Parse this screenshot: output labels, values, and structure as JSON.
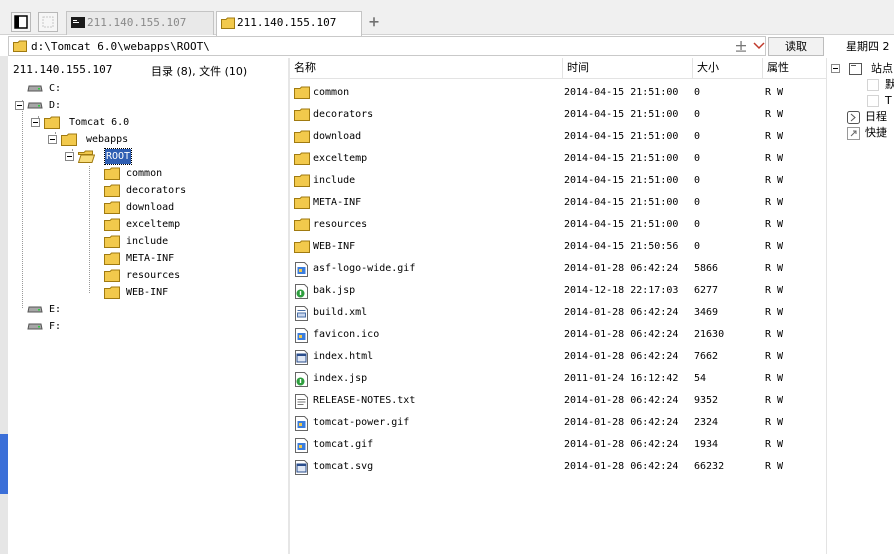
{
  "tabs": [
    {
      "label": "211.140.155.107",
      "icon": "terminal-icon",
      "active": false
    },
    {
      "label": "211.140.155.107",
      "icon": "folder-icon",
      "active": true
    }
  ],
  "toolbar": {
    "path_value": "d:\\Tomcat 6.0\\webapps\\ROOT\\",
    "read_label": "读取",
    "date_label": "星期四 2"
  },
  "tree": {
    "server_label": "211.140.155.107",
    "count_label": "目录 (8), 文件 (10)",
    "nodes": [
      {
        "label": "C:",
        "type": "drive"
      },
      {
        "label": "D:",
        "type": "drive"
      },
      {
        "label": "Tomcat 6.0",
        "type": "folder"
      },
      {
        "label": "webapps",
        "type": "folder"
      },
      {
        "label": "ROOT",
        "type": "folder",
        "selected": true
      },
      {
        "label": "common",
        "type": "folder"
      },
      {
        "label": "decorators",
        "type": "folder"
      },
      {
        "label": "download",
        "type": "folder"
      },
      {
        "label": "exceltemp",
        "type": "folder"
      },
      {
        "label": "include",
        "type": "folder"
      },
      {
        "label": "META-INF",
        "type": "folder"
      },
      {
        "label": "resources",
        "type": "folder"
      },
      {
        "label": "WEB-INF",
        "type": "folder"
      },
      {
        "label": "E:",
        "type": "drive"
      },
      {
        "label": "F:",
        "type": "drive"
      }
    ]
  },
  "files": {
    "columns": {
      "name": "名称",
      "time": "时间",
      "size": "大小",
      "attr": "属性"
    },
    "rows": [
      {
        "name": "common",
        "time": "2014-04-15 21:51:00",
        "size": "0",
        "attr": "R W",
        "icon": "folder-icon"
      },
      {
        "name": "decorators",
        "time": "2014-04-15 21:51:00",
        "size": "0",
        "attr": "R W",
        "icon": "folder-icon"
      },
      {
        "name": "download",
        "time": "2014-04-15 21:51:00",
        "size": "0",
        "attr": "R W",
        "icon": "folder-icon"
      },
      {
        "name": "exceltemp",
        "time": "2014-04-15 21:51:00",
        "size": "0",
        "attr": "R W",
        "icon": "folder-icon"
      },
      {
        "name": "include",
        "time": "2014-04-15 21:51:00",
        "size": "0",
        "attr": "R W",
        "icon": "folder-icon"
      },
      {
        "name": "META-INF",
        "time": "2014-04-15 21:51:00",
        "size": "0",
        "attr": "R W",
        "icon": "folder-icon"
      },
      {
        "name": "resources",
        "time": "2014-04-15 21:51:00",
        "size": "0",
        "attr": "R W",
        "icon": "folder-icon"
      },
      {
        "name": "WEB-INF",
        "time": "2014-04-15 21:50:56",
        "size": "0",
        "attr": "R W",
        "icon": "folder-icon"
      },
      {
        "name": "asf-logo-wide.gif",
        "time": "2014-01-28 06:42:24",
        "size": "5866",
        "attr": "R W",
        "icon": "image-file-icon"
      },
      {
        "name": "bak.jsp",
        "time": "2014-12-18 22:17:03",
        "size": "6277",
        "attr": "R W",
        "icon": "jsp-file-icon"
      },
      {
        "name": "build.xml",
        "time": "2014-01-28 06:42:24",
        "size": "3469",
        "attr": "R W",
        "icon": "xml-file-icon"
      },
      {
        "name": "favicon.ico",
        "time": "2014-01-28 06:42:24",
        "size": "21630",
        "attr": "R W",
        "icon": "image-file-icon"
      },
      {
        "name": "index.html",
        "time": "2014-01-28 06:42:24",
        "size": "7662",
        "attr": "R W",
        "icon": "html-file-icon"
      },
      {
        "name": "index.jsp",
        "time": "2011-01-24 16:12:42",
        "size": "54",
        "attr": "R W",
        "icon": "jsp-file-icon"
      },
      {
        "name": "RELEASE-NOTES.txt",
        "time": "2014-01-28 06:42:24",
        "size": "9352",
        "attr": "R W",
        "icon": "text-file-icon"
      },
      {
        "name": "tomcat-power.gif",
        "time": "2014-01-28 06:42:24",
        "size": "2324",
        "attr": "R W",
        "icon": "image-file-icon"
      },
      {
        "name": "tomcat.gif",
        "time": "2014-01-28 06:42:24",
        "size": "1934",
        "attr": "R W",
        "icon": "image-file-icon"
      },
      {
        "name": "tomcat.svg",
        "time": "2014-01-28 06:42:24",
        "size": "66232",
        "attr": "R W",
        "icon": "html-file-icon"
      }
    ]
  },
  "right_panel": {
    "site_label": "站点",
    "sub_a": "默",
    "sub_b": "T",
    "schedule_label": "日程",
    "shortcut_label": "快捷"
  },
  "colors": {
    "selection": "#2f5fb3",
    "folder": "#f2c94c",
    "tab_bg": "#f0f0f0"
  }
}
